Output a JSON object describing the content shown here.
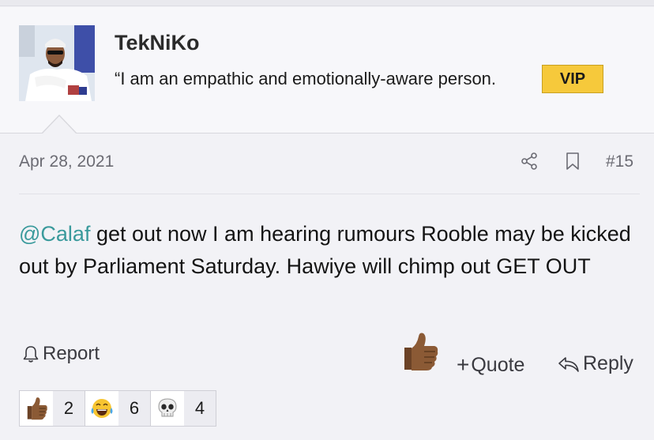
{
  "user": {
    "name": "TekNiKo",
    "title": "“I am an empathic and emotionally-aware person.",
    "badge": "VIP"
  },
  "post": {
    "date": "Apr 28, 2021",
    "number": "#15",
    "mention": "@Calaf",
    "body": " get out now I am hearing rumours Rooble may be kicked out by Parliament Saturday. Hawiye will chimp out GET OUT"
  },
  "actions": {
    "report": "Report",
    "quote_plus": "+",
    "quote": "Quote",
    "reply": "Reply"
  },
  "reactions": [
    {
      "icon": "thumbs-up-icon",
      "count": "2"
    },
    {
      "icon": "laughing-tears-icon",
      "count": "6"
    },
    {
      "icon": "skull-icon",
      "count": "4"
    }
  ],
  "colors": {
    "mention": "#3a9a9c",
    "vip_badge": "#f6c93b"
  }
}
